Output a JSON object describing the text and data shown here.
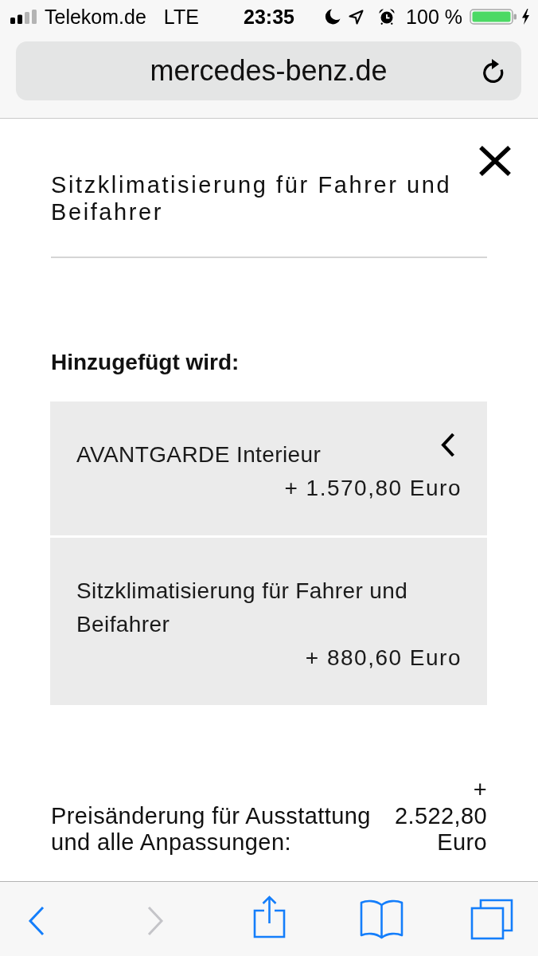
{
  "status_bar": {
    "carrier": "Telekom.de",
    "network": "LTE",
    "time": "23:35",
    "battery": "100 %"
  },
  "browser": {
    "url": "mercedes-benz.de"
  },
  "dialog": {
    "title": "Sitzklimatisierung für Fahrer und Beifahrer",
    "section_heading": "Hinzugefügt wird:",
    "items": [
      {
        "name": "AVANTGARDE Interieur",
        "price": "+ 1.570,80 Euro",
        "expandable": true
      },
      {
        "name": "Sitzklimatisierung für Fahrer und Beifahrer",
        "price": "+ 880,60 Euro",
        "expandable": false
      }
    ],
    "total": {
      "label": "Preisänderung für Ausstattung und alle Anpassungen:",
      "value": "+ 2.522,80 Euro"
    }
  },
  "toolbar": [
    {
      "kind": "back",
      "disabled": false
    },
    {
      "kind": "forward",
      "disabled": true
    },
    {
      "kind": "share",
      "disabled": false
    },
    {
      "kind": "bookmarks",
      "disabled": false
    },
    {
      "kind": "tabs",
      "disabled": false
    }
  ]
}
